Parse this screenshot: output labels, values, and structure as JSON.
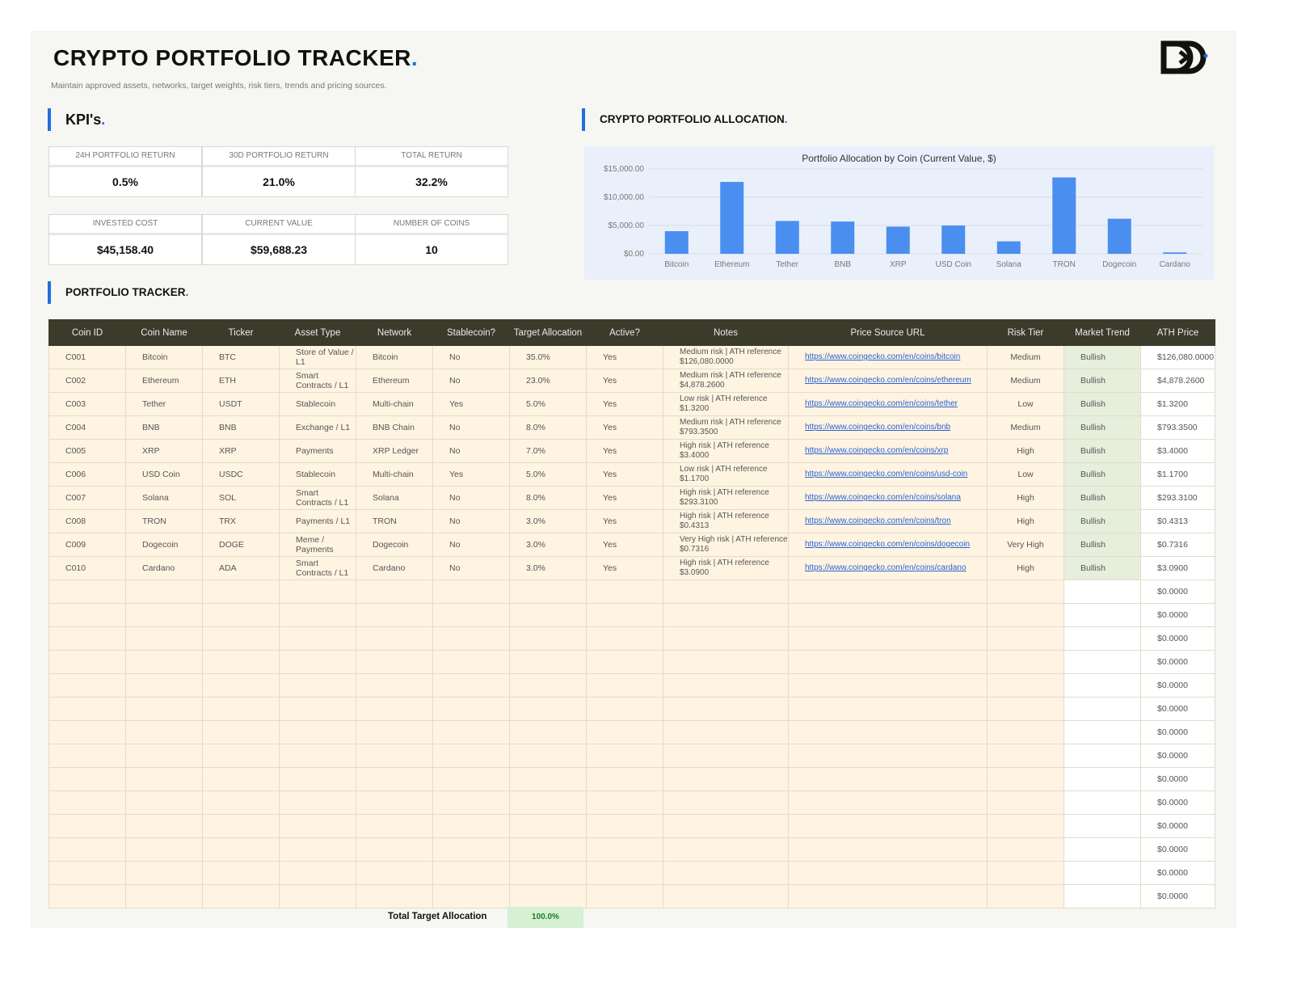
{
  "header": {
    "title": "CRYPTO PORTFOLIO TRACKER",
    "title_dot": ".",
    "subtitle": "Maintain approved assets, networks, target weights, risk tiers, trends and pricing sources."
  },
  "kpis": {
    "section_title": "KPI's",
    "section_dot": ".",
    "items": [
      {
        "label": "24H PORTFOLIO RETURN",
        "value": "0.5%"
      },
      {
        "label": "30D PORTFOLIO RETURN",
        "value": "21.0%"
      },
      {
        "label": "TOTAL RETURN",
        "value": "32.2%"
      },
      {
        "label": "INVESTED COST",
        "value": "$45,158.40"
      },
      {
        "label": "CURRENT VALUE",
        "value": "$59,688.23"
      },
      {
        "label": "NUMBER OF COINS",
        "value": "10"
      }
    ]
  },
  "allocation": {
    "section_title": "CRYPTO PORTFOLIO ALLOCATION",
    "section_dot": "."
  },
  "chart_data": {
    "type": "bar",
    "title": "Portfolio Allocation by Coin (Current Value, $)",
    "categories": [
      "Bitcoin",
      "Ethereum",
      "Tether",
      "BNB",
      "XRP",
      "USD Coin",
      "Solana",
      "TRON",
      "Dogecoin",
      "Cardano"
    ],
    "values": [
      4000,
      12700,
      5800,
      5700,
      4800,
      5000,
      2200,
      13500,
      6200,
      250
    ],
    "ylim": [
      0,
      15000
    ],
    "yticks": [
      "$0.00",
      "$5,000.00",
      "$10,000.00",
      "$15,000.00"
    ],
    "ytick_values": [
      0,
      5000,
      10000,
      15000
    ],
    "bar_color": "#4a8ef0",
    "grid": true
  },
  "tracker": {
    "section_title": "PORTFOLIO TRACKER",
    "section_dot": ".",
    "columns": [
      "Coin ID",
      "Coin Name",
      "Ticker",
      "Asset Type",
      "Network",
      "Stablecoin?",
      "Target Allocation",
      "Active?",
      "Notes",
      "Price Source URL",
      "Risk Tier",
      "Market Trend",
      "ATH Price"
    ],
    "rows": [
      [
        "C001",
        "Bitcoin",
        "BTC",
        "Store of Value / L1",
        "Bitcoin",
        "No",
        "35.0%",
        "Yes",
        "Medium risk | ATH reference $126,080.0000",
        "https://www.coingecko.com/en/coins/bitcoin",
        "Medium",
        "Bullish",
        "$126,080.0000"
      ],
      [
        "C002",
        "Ethereum",
        "ETH",
        "Smart Contracts / L1",
        "Ethereum",
        "No",
        "23.0%",
        "Yes",
        "Medium risk | ATH reference $4,878.2600",
        "https://www.coingecko.com/en/coins/ethereum",
        "Medium",
        "Bullish",
        "$4,878.2600"
      ],
      [
        "C003",
        "Tether",
        "USDT",
        "Stablecoin",
        "Multi-chain",
        "Yes",
        "5.0%",
        "Yes",
        "Low risk | ATH reference $1.3200",
        "https://www.coingecko.com/en/coins/tether",
        "Low",
        "Bullish",
        "$1.3200"
      ],
      [
        "C004",
        "BNB",
        "BNB",
        "Exchange / L1",
        "BNB Chain",
        "No",
        "8.0%",
        "Yes",
        "Medium risk | ATH reference $793.3500",
        "https://www.coingecko.com/en/coins/bnb",
        "Medium",
        "Bullish",
        "$793.3500"
      ],
      [
        "C005",
        "XRP",
        "XRP",
        "Payments",
        "XRP Ledger",
        "No",
        "7.0%",
        "Yes",
        "High risk | ATH reference $3.4000",
        "https://www.coingecko.com/en/coins/xrp",
        "High",
        "Bullish",
        "$3.4000"
      ],
      [
        "C006",
        "USD Coin",
        "USDC",
        "Stablecoin",
        "Multi-chain",
        "Yes",
        "5.0%",
        "Yes",
        "Low risk | ATH reference $1.1700",
        "https://www.coingecko.com/en/coins/usd-coin",
        "Low",
        "Bullish",
        "$1.1700"
      ],
      [
        "C007",
        "Solana",
        "SOL",
        "Smart Contracts / L1",
        "Solana",
        "No",
        "8.0%",
        "Yes",
        "High risk | ATH reference $293.3100",
        "https://www.coingecko.com/en/coins/solana",
        "High",
        "Bullish",
        "$293.3100"
      ],
      [
        "C008",
        "TRON",
        "TRX",
        "Payments / L1",
        "TRON",
        "No",
        "3.0%",
        "Yes",
        "High risk | ATH reference $0.4313",
        "https://www.coingecko.com/en/coins/tron",
        "High",
        "Bullish",
        "$0.4313"
      ],
      [
        "C009",
        "Dogecoin",
        "DOGE",
        "Meme / Payments",
        "Dogecoin",
        "No",
        "3.0%",
        "Yes",
        "Very High risk | ATH reference $0.7316",
        "https://www.coingecko.com/en/coins/dogecoin",
        "Very High",
        "Bullish",
        "$0.7316"
      ],
      [
        "C010",
        "Cardano",
        "ADA",
        "Smart Contracts / L1",
        "Cardano",
        "No",
        "3.0%",
        "Yes",
        "High risk | ATH reference $3.0900",
        "https://www.coingecko.com/en/coins/cardano",
        "High",
        "Bullish",
        "$3.0900"
      ]
    ],
    "empty_rows_ath": [
      "$0.0000",
      "$0.0000",
      "$0.0000",
      "$0.0000",
      "$0.0000",
      "$0.0000",
      "$0.0000",
      "$0.0000",
      "$0.0000",
      "$0.0000",
      "$0.0000",
      "$0.0000",
      "$0.0000",
      "$0.0000"
    ],
    "total_label": "Total Target Allocation",
    "total_value": "100.0%"
  },
  "colors": {
    "accent": "#1f6fe0",
    "header_bg": "#3b3b2b",
    "row_bg": "#fff4e2",
    "trend_bg": "#e6eedc",
    "total_bg": "#d5f0d3"
  },
  "icons": {
    "logo": "dd-brand-logo-icon"
  }
}
